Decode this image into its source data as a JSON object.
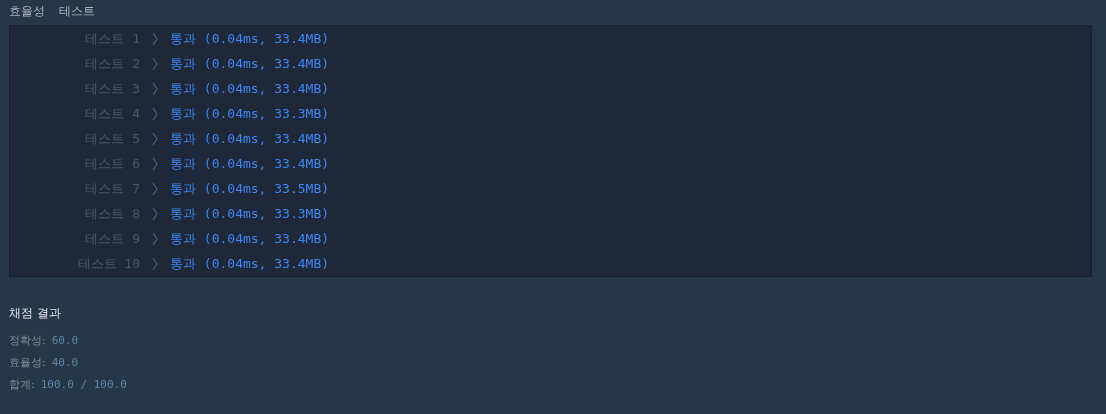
{
  "header": {
    "title": "효율성",
    "subtitle": "테스트"
  },
  "tests": [
    {
      "label": "테스트 1",
      "passed": true,
      "result": "통과",
      "detail": "(0.04ms, 33.4MB)"
    },
    {
      "label": "테스트 2",
      "passed": true,
      "result": "통과",
      "detail": "(0.04ms, 33.4MB)"
    },
    {
      "label": "테스트 3",
      "passed": true,
      "result": "통과",
      "detail": "(0.04ms, 33.4MB)"
    },
    {
      "label": "테스트 4",
      "passed": true,
      "result": "통과",
      "detail": "(0.04ms, 33.3MB)"
    },
    {
      "label": "테스트 5",
      "passed": true,
      "result": "통과",
      "detail": "(0.04ms, 33.4MB)"
    },
    {
      "label": "테스트 6",
      "passed": true,
      "result": "통과",
      "detail": "(0.04ms, 33.4MB)"
    },
    {
      "label": "테스트 7",
      "passed": true,
      "result": "통과",
      "detail": "(0.04ms, 33.5MB)"
    },
    {
      "label": "테스트 8",
      "passed": true,
      "result": "통과",
      "detail": "(0.04ms, 33.3MB)"
    },
    {
      "label": "테스트 9",
      "passed": true,
      "result": "통과",
      "detail": "(0.04ms, 33.4MB)"
    },
    {
      "label": "테스트 10",
      "passed": true,
      "result": "통과",
      "detail": "(0.04ms, 33.4MB)"
    }
  ],
  "grading": {
    "title": "채점 결과",
    "scores": [
      {
        "label": "정확성:",
        "value": "60.0"
      },
      {
        "label": "효율성:",
        "value": "40.0"
      },
      {
        "label": "합계:",
        "value": "100.0 / 100.0"
      }
    ]
  }
}
